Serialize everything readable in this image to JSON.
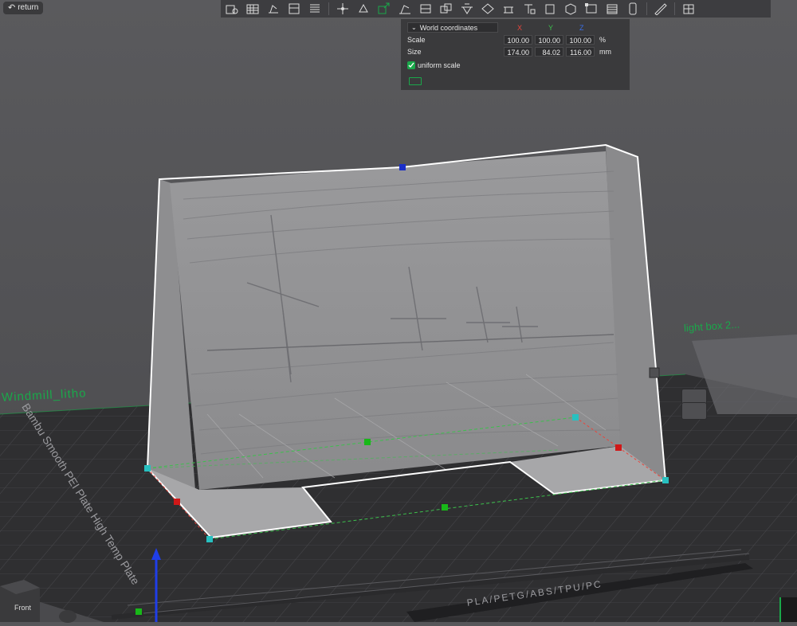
{
  "top_bar": {
    "return_label": "return"
  },
  "toolbar": {
    "icons": [
      "add-object-icon",
      "grid-arrange-icon",
      "auto-orient-icon",
      "layout-icon",
      "layers-list-icon",
      "move-icon",
      "rotate-icon",
      "scale-icon",
      "lay-on-face-icon",
      "split-icon",
      "cut-icon",
      "mesh-boolean-icon",
      "paint-seam-icon",
      "support-paint-icon",
      "text-icon",
      "color-paint-icon",
      "fuzzy-skin-icon",
      "measure-box-icon",
      "variable-layer-icon",
      "assembly-icon",
      "ruler-icon",
      "view-all-icon"
    ]
  },
  "scale_panel": {
    "coord_select": "World coordinates",
    "axes": [
      "X",
      "Y",
      "Z"
    ],
    "axis_colors": [
      "#e8453c",
      "#3cbf4c",
      "#3a6fe8"
    ],
    "rows": [
      {
        "label": "Scale",
        "values": [
          "100.00",
          "100.00",
          "100.00"
        ],
        "unit": "%"
      },
      {
        "label": "Size",
        "values": [
          "174.00",
          "84.02",
          "116.00"
        ],
        "unit": "mm"
      }
    ],
    "uniform_scale_label": "uniform scale",
    "uniform_scale_checked": true
  },
  "scene": {
    "object_label_left": "Windmill_litho",
    "object_label_right": "light box 2...",
    "plate_text_side": "Bambu Smooth PEI Plate  High Temp Plate",
    "plate_text_bottom": "PLA/PETG/ABS/TPU/PC",
    "view_label": "Front",
    "accent_color": "#1aa84a"
  }
}
